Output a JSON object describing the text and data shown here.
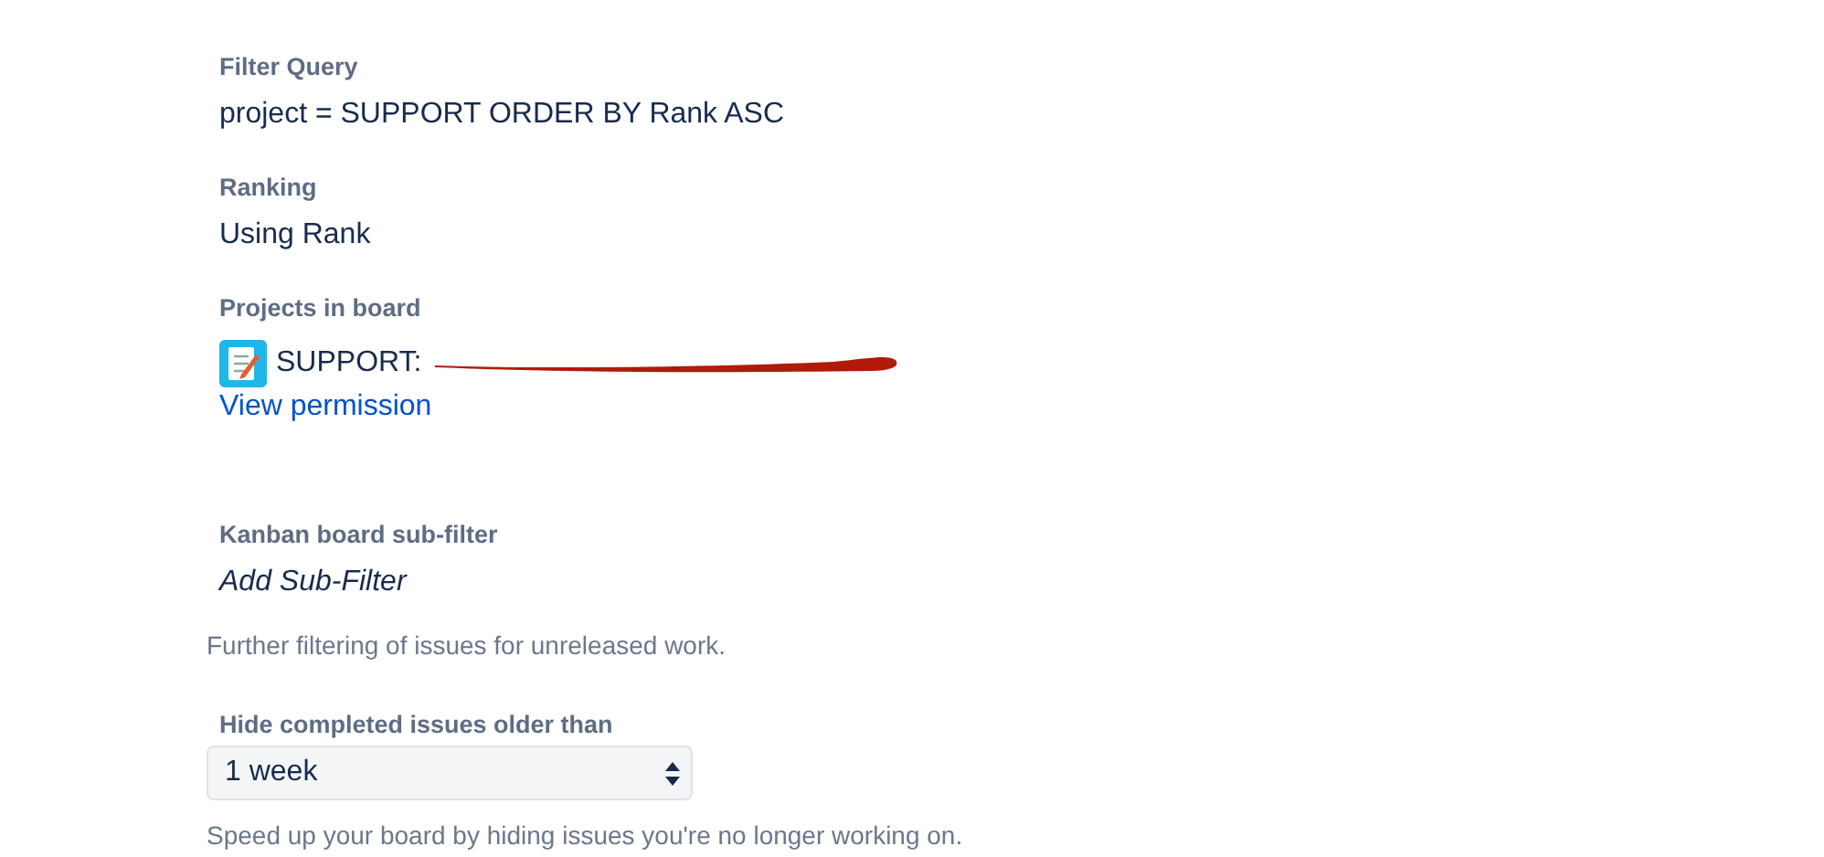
{
  "filter_query": {
    "label": "Filter Query",
    "value": "project = SUPPORT ORDER BY Rank ASC"
  },
  "ranking": {
    "label": "Ranking",
    "value": "Using Rank"
  },
  "projects": {
    "label": "Projects in board",
    "items": [
      {
        "name": "SUPPORT:",
        "redacted": true
      }
    ],
    "link": "View permission"
  },
  "sub_filter": {
    "label": "Kanban board sub-filter",
    "value": "Add Sub-Filter",
    "help": "Further filtering of issues for unreleased work."
  },
  "hide_completed": {
    "label": "Hide completed issues older than",
    "value": "1 week",
    "help": "Speed up your board by hiding issues you're no longer working on."
  }
}
